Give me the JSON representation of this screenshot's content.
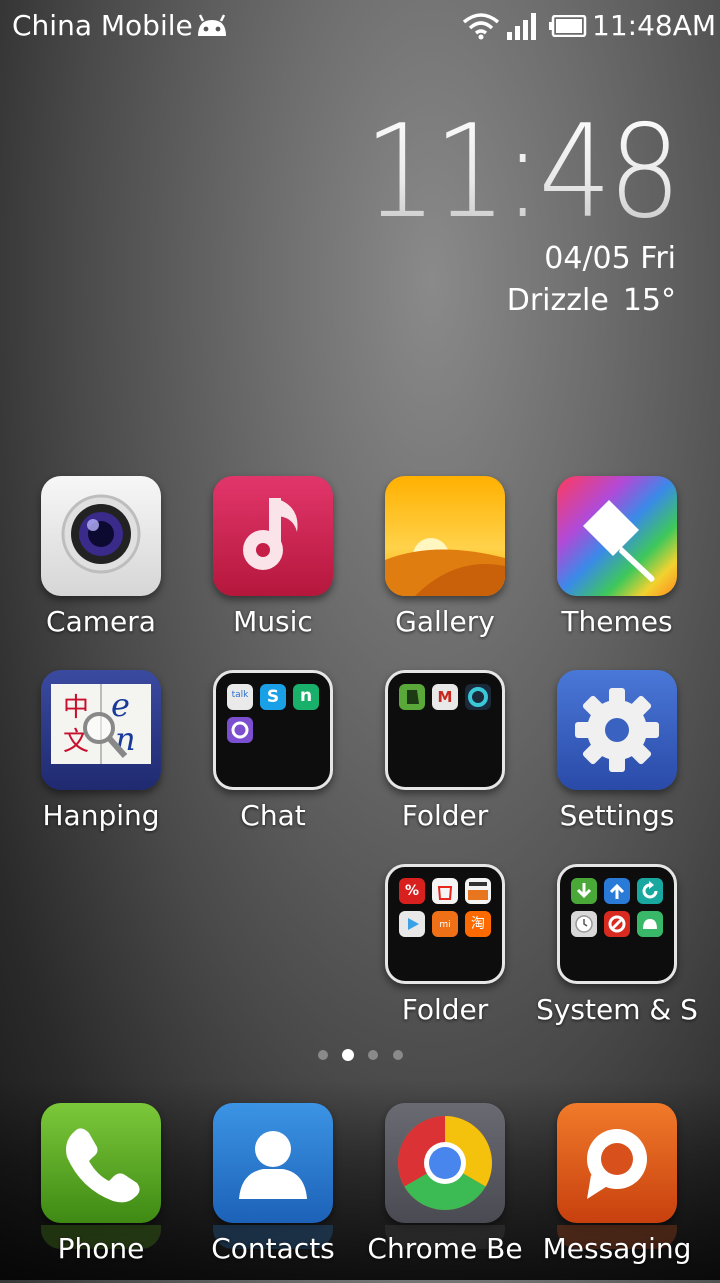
{
  "status_bar": {
    "carrier": "China Mobile",
    "notification_icon": "android-icon",
    "wifi_icon": "wifi-icon",
    "signal_icon": "signal-icon",
    "battery_icon": "battery-icon",
    "time": "11:48AM"
  },
  "clock_widget": {
    "time": "11:48",
    "date": "04/05 Fri",
    "weather_condition": "Drizzle",
    "temperature": "15°"
  },
  "apps": [
    {
      "label": "Camera",
      "icon": "camera-icon"
    },
    {
      "label": "Music",
      "icon": "music-icon"
    },
    {
      "label": "Gallery",
      "icon": "gallery-icon"
    },
    {
      "label": "Themes",
      "icon": "themes-icon"
    },
    {
      "label": "Hanping",
      "icon": "hanping-icon"
    },
    {
      "label": "Chat",
      "icon": "folder-icon",
      "contents": [
        "talk-icon",
        "skype-icon",
        "n-icon",
        "viber-icon"
      ]
    },
    {
      "label": "Folder",
      "icon": "folder-icon",
      "contents": [
        "evernote-icon",
        "gmail-icon",
        "circle-app-icon"
      ]
    },
    {
      "label": "Settings",
      "icon": "settings-icon"
    },
    {
      "label": "Folder",
      "icon": "folder-icon",
      "contents": [
        "deals-icon",
        "shopping-icon",
        "amazon-icon",
        "play-store-icon",
        "mi-store-icon",
        "taobao-icon"
      ]
    },
    {
      "label": "System & S",
      "icon": "folder-icon",
      "contents": [
        "download-icon",
        "upload-icon",
        "refresh-icon",
        "clock-icon",
        "block-icon",
        "android-icon"
      ]
    }
  ],
  "page_indicator": {
    "pages": 4,
    "current": 2
  },
  "dock": [
    {
      "label": "Phone",
      "icon": "phone-icon"
    },
    {
      "label": "Contacts",
      "icon": "contacts-icon"
    },
    {
      "label": "Chrome Be",
      "icon": "chrome-icon"
    },
    {
      "label": "Messaging",
      "icon": "messaging-icon"
    }
  ],
  "colors": {
    "music": "#d0264f",
    "phone": "#5aa81e",
    "contacts": "#2a7fd4",
    "messaging": "#e0561c",
    "settings": "#3a62c0"
  }
}
